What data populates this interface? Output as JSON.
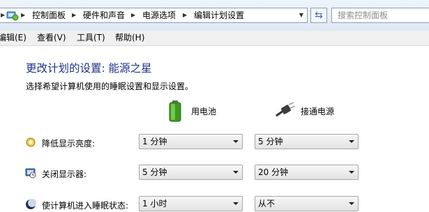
{
  "address_bar": {
    "breadcrumbs": [
      "控制面板",
      "硬件和声音",
      "电源选项",
      "编辑计划设置"
    ]
  },
  "search": {
    "placeholder": "搜索控制面板"
  },
  "menu": [
    "编辑(E)",
    "查看(V)",
    "工具(T)",
    "帮助(H)"
  ],
  "page": {
    "title": "更改计划的设置: 能源之星",
    "subtitle": "选择希望计算机使用的睡眠设置和显示设置。"
  },
  "columns": {
    "battery": "用电池",
    "plugged": "接通电源"
  },
  "rows": [
    {
      "label": "降低显示亮度:",
      "icon": "brightness-icon",
      "battery": "1 分钟",
      "plugged": "5 分钟"
    },
    {
      "label": "关闭显示器:",
      "icon": "monitor-clock-icon",
      "battery": "5 分钟",
      "plugged": "20 分钟"
    },
    {
      "label": "使计算机进入睡眠状态:",
      "icon": "moon-sleep-icon",
      "battery": "1 小时",
      "plugged": "从不"
    }
  ],
  "colors": {
    "title": "#1e3287",
    "battery_green": "#4caf2c"
  }
}
